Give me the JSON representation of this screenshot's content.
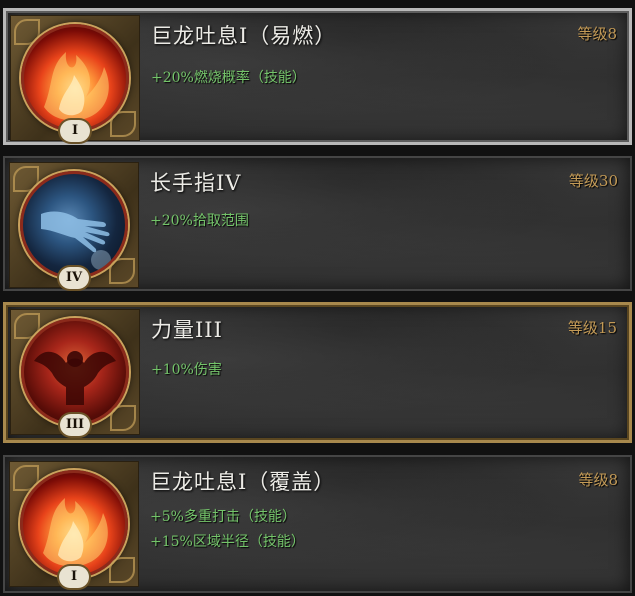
{
  "skills": [
    {
      "name": "巨龙吐息I（易燃）",
      "level": "等级8",
      "numeral": "I",
      "icon": "fire-breath-icon",
      "bonuses": [
        "+20%燃烧概率（技能）"
      ]
    },
    {
      "name": "长手指IV",
      "level": "等级30",
      "numeral": "IV",
      "icon": "reaching-hand-icon",
      "bonuses": [
        "+20%拾取范围"
      ]
    },
    {
      "name": "力量III",
      "level": "等级15",
      "numeral": "III",
      "icon": "muscle-figure-icon",
      "bonuses": [
        "+10%伤害"
      ]
    },
    {
      "name": "巨龙吐息I（覆盖）",
      "level": "等级8",
      "numeral": "I",
      "icon": "fire-breath-icon",
      "bonuses": [
        "+5%多重打击（技能）",
        "+15%区域半径（技能）"
      ]
    }
  ],
  "colors": {
    "bonus_text": "#74c46a",
    "level_text": "#c39a56",
    "selected_silver_border": "#b9b9b9",
    "selected_gold_border": "#a8894d"
  }
}
